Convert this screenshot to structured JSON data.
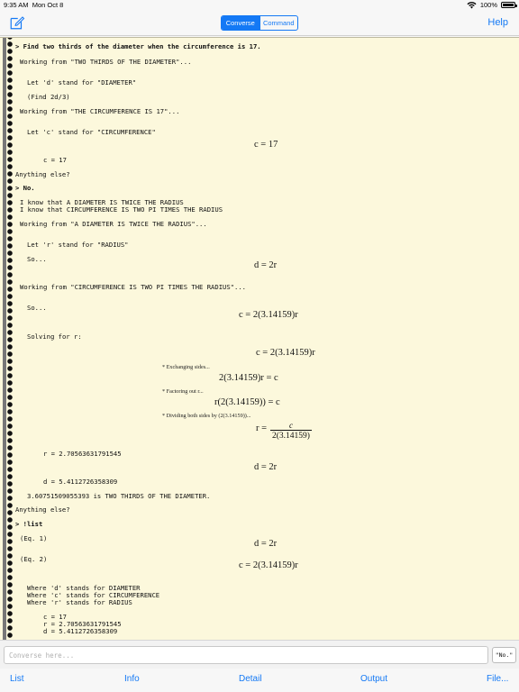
{
  "status_bar": {
    "time": "9:35 AM",
    "date": "Mon Oct 8",
    "battery": "100%"
  },
  "nav": {
    "segments": [
      "Converse",
      "Command"
    ],
    "active_segment": "Converse",
    "help": "Help",
    "compose_icon": "compose-icon"
  },
  "transcript": {
    "l01": "> Find two thirds of the diameter when the circumference is 17.",
    "l02": "Working from \"TWO THIRDS OF THE DIAMETER\"...",
    "l03": "Let 'd' stand for \"DIAMETER\"",
    "l04": "(Find 2d/3)",
    "l05": "Working from \"THE CIRCUMFERENCE IS 17\"...",
    "l06": "Let 'c' stand for \"CIRCUMFERENCE\"",
    "m01": "c = 17",
    "l07": "c = 17",
    "l08": "Anything else?",
    "l09": "> No.",
    "l10": "I know that A DIAMETER IS TWICE THE RADIUS",
    "l11": "I know that CIRCUMFERENCE IS TWO PI TIMES THE RADIUS",
    "l12": "Working from \"A DIAMETER IS TWICE THE RADIUS\"...",
    "l13": "Let 'r' stand for \"RADIUS\"",
    "l14": "So...",
    "m02": "d = 2r",
    "l15": "Working from \"CIRCUMFERENCE IS TWO PI TIMES THE RADIUS\"...",
    "l16": "So...",
    "m03": "c = 2(3.14159)r",
    "l17": "Solving for r:",
    "m04": "c = 2(3.14159)r",
    "n01": "* Exchanging sides...",
    "m05": "2(3.14159)r = c",
    "n02": "* Factoring out r...",
    "m06": "r(2(3.14159)) = c",
    "n03": "* Dividing both sides by (2(3.14159))...",
    "m07_left": "r =",
    "m07_num": "c",
    "m07_den": "2(3.14159)",
    "l18": "r = 2.70563631791545",
    "m08": "d = 2r",
    "l19": "d = 5.4112726358309",
    "l20": "3.60751509055393 is TWO THIRDS OF THE DIAMETER.",
    "l21": "Anything else?",
    "l22": "> !list",
    "l23": "(Eq. 1)",
    "m09": "d = 2r",
    "l24": "(Eq. 2)",
    "m10": "c = 2(3.14159)r",
    "l25": "Where 'd' stands for DIAMETER",
    "l26": "Where 'c' stands for CIRCUMFERENCE",
    "l27": "Where 'r' stands for RADIUS",
    "l28": "c = 17",
    "l29": "r = 2.70563631791545",
    "l30": "d = 5.4112726358309"
  },
  "input": {
    "placeholder": "Converse here...",
    "value": "",
    "suggestion": "\"No.\""
  },
  "toolbar": {
    "list": "List",
    "info": "Info",
    "detail": "Detail",
    "output": "Output",
    "file": "File..."
  },
  "colors": {
    "accent": "#1479f5",
    "paper": "#fcf8dc"
  }
}
